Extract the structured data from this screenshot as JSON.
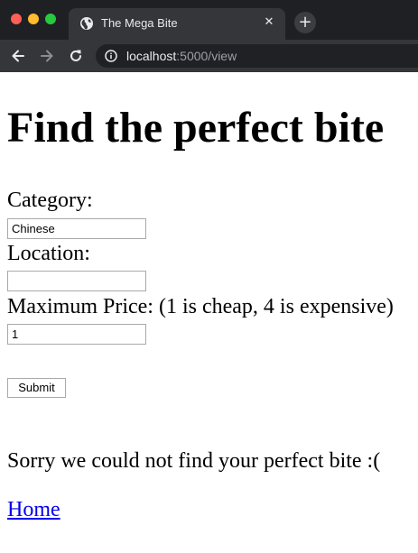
{
  "browser": {
    "tab": {
      "title": "The Mega Bite",
      "favicon": "globe-icon",
      "close_glyph": "✕"
    },
    "new_tab_glyph": "+",
    "address_bar": {
      "host": "localhost",
      "path": ":5000/view",
      "icon": "info-icon"
    },
    "nav_icons": [
      "back-arrow-icon",
      "forward-arrow-icon",
      "reload-icon"
    ],
    "colors": {
      "frame": "#1f2023",
      "toolbar": "#35363a",
      "omnibox": "#202124",
      "close": "#fe5f57",
      "minimize": "#febc2e",
      "maximize": "#28c840"
    }
  },
  "page": {
    "title": "Find the perfect bite",
    "form": {
      "category_label": "Category:",
      "category_value": "Chinese",
      "location_label": "Location:",
      "location_value": "",
      "price_label": "Maximum Price: (1 is cheap, 4 is expensive)",
      "price_value": "1",
      "submit_label": "Submit"
    },
    "result_message": "Sorry we could not find your perfect bite :(",
    "home_link": "Home",
    "link_color": "#0000ee"
  }
}
